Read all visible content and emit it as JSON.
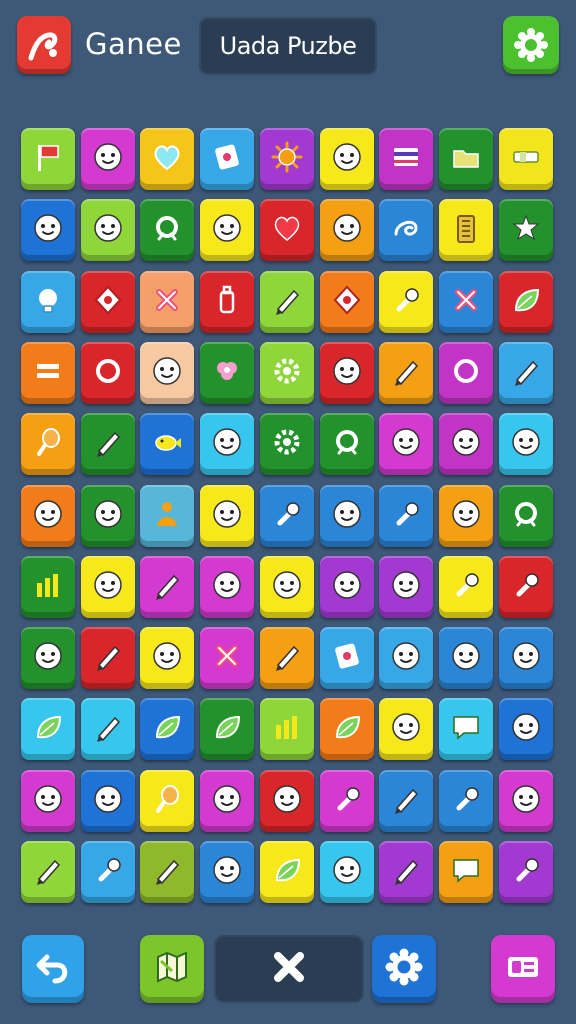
{
  "header": {
    "app_title": "Ganee",
    "puzzle_title": "Uada Puzbe",
    "app_icon": "flag-icon",
    "settings_icon": "gear-icon"
  },
  "board": {
    "rows": 11,
    "cols": 9,
    "tiles": [
      [
        "#8fd63a",
        "flag"
      ],
      [
        "#d43ad0",
        "face"
      ],
      [
        "#f5c51a",
        "heart-outline"
      ],
      [
        "#37a7e8",
        "card"
      ],
      [
        "#a23ad2",
        "sun"
      ],
      [
        "#f7e81c",
        "face"
      ],
      [
        "#c234c6",
        "stripes"
      ],
      [
        "#23922c",
        "folder"
      ],
      [
        "#f2e51c",
        "bar"
      ],
      [
        "#1f73d6",
        "face"
      ],
      [
        "#8fd63a",
        "face"
      ],
      [
        "#23922c",
        "ring"
      ],
      [
        "#f7e81c",
        "face"
      ],
      [
        "#d8262a",
        "heart"
      ],
      [
        "#f59f12",
        "face"
      ],
      [
        "#2b86d8",
        "swirl"
      ],
      [
        "#f7e81c",
        "battery"
      ],
      [
        "#23922c",
        "star"
      ],
      [
        "#37a7e8",
        "bulb"
      ],
      [
        "#d8262a",
        "diamond"
      ],
      [
        "#f59f6a",
        "cross"
      ],
      [
        "#d8262a",
        "bottle"
      ],
      [
        "#8fd63a",
        "pencil"
      ],
      [
        "#f27c1a",
        "diamond"
      ],
      [
        "#f7e81c",
        "tool"
      ],
      [
        "#2b86d8",
        "cross"
      ],
      [
        "#d8262a",
        "leaf"
      ],
      [
        "#f27c1a",
        "equal"
      ],
      [
        "#d8262a",
        "circle"
      ],
      [
        "#f7c9a3",
        "face"
      ],
      [
        "#23922c",
        "flower"
      ],
      [
        "#8fd63a",
        "gear"
      ],
      [
        "#d8262a",
        "face"
      ],
      [
        "#f59f12",
        "pencil"
      ],
      [
        "#c234c6",
        "circle"
      ],
      [
        "#37a7e8",
        "pencil"
      ],
      [
        "#f59f12",
        "drumstick"
      ],
      [
        "#23922c",
        "pencil"
      ],
      [
        "#1f73d6",
        "fish"
      ],
      [
        "#37c7ee",
        "face"
      ],
      [
        "#23922c",
        "gear"
      ],
      [
        "#23922c",
        "ring"
      ],
      [
        "#d43ad0",
        "face"
      ],
      [
        "#c234c6",
        "face"
      ],
      [
        "#37c7ee",
        "face"
      ],
      [
        "#f27c1a",
        "face"
      ],
      [
        "#23922c",
        "face"
      ],
      [
        "#57b7d8",
        "person"
      ],
      [
        "#f7e81c",
        "face"
      ],
      [
        "#2b86d8",
        "tool"
      ],
      [
        "#2b86d8",
        "face"
      ],
      [
        "#2b86d8",
        "tool"
      ],
      [
        "#f59f12",
        "face"
      ],
      [
        "#23922c",
        "ring"
      ],
      [
        "#23922c",
        "chart"
      ],
      [
        "#f7e81c",
        "face"
      ],
      [
        "#d43ad0",
        "pencil"
      ],
      [
        "#d43ad0",
        "face"
      ],
      [
        "#f7e81c",
        "face"
      ],
      [
        "#a23ad2",
        "face"
      ],
      [
        "#a23ad2",
        "face"
      ],
      [
        "#f7e81c",
        "tool"
      ],
      [
        "#d8262a",
        "tool"
      ],
      [
        "#23922c",
        "face"
      ],
      [
        "#d8262a",
        "pencil"
      ],
      [
        "#f7e81c",
        "face"
      ],
      [
        "#d43ad0",
        "cross"
      ],
      [
        "#f59f12",
        "pencil"
      ],
      [
        "#37a7e8",
        "card"
      ],
      [
        "#37a7e8",
        "face"
      ],
      [
        "#2b86d8",
        "face"
      ],
      [
        "#2b86d8",
        "face"
      ],
      [
        "#37c7ee",
        "leaf"
      ],
      [
        "#37c7ee",
        "pencil"
      ],
      [
        "#1f73d6",
        "leaf"
      ],
      [
        "#23922c",
        "leaf"
      ],
      [
        "#8fd63a",
        "chart"
      ],
      [
        "#f27c1a",
        "leaf"
      ],
      [
        "#f7e81c",
        "face"
      ],
      [
        "#37c7ee",
        "chat"
      ],
      [
        "#1f73d6",
        "face"
      ],
      [
        "#d43ad0",
        "face"
      ],
      [
        "#1f73d6",
        "face"
      ],
      [
        "#f7e81c",
        "drumstick"
      ],
      [
        "#d43ad0",
        "face"
      ],
      [
        "#d8262a",
        "face"
      ],
      [
        "#d43ad0",
        "tool"
      ],
      [
        "#2b86d8",
        "pencil"
      ],
      [
        "#2b86d8",
        "tool"
      ],
      [
        "#d43ad0",
        "face"
      ],
      [
        "#8fd63a",
        "pencil"
      ],
      [
        "#37a7e8",
        "tool"
      ],
      [
        "#8fb82a",
        "pencil"
      ],
      [
        "#2b86d8",
        "face"
      ],
      [
        "#f7e81c",
        "leaf"
      ],
      [
        "#37c7ee",
        "face"
      ],
      [
        "#a23ad2",
        "pencil"
      ],
      [
        "#f59f12",
        "chat"
      ],
      [
        "#a23ad2",
        "tool"
      ]
    ]
  },
  "controls": {
    "undo_icon": "undo-icon",
    "map_icon": "map-icon",
    "shuffle_icon": "shuffle-icon",
    "settings_icon": "gear-icon",
    "card_icon": "card-icon"
  },
  "colors": {
    "background": "#3e5878",
    "undo": "#2fa2ea",
    "map": "#7cc62c",
    "shuffle_panel": "#2b3d52",
    "settings": "#1f73d6",
    "card": "#d43ad0"
  }
}
